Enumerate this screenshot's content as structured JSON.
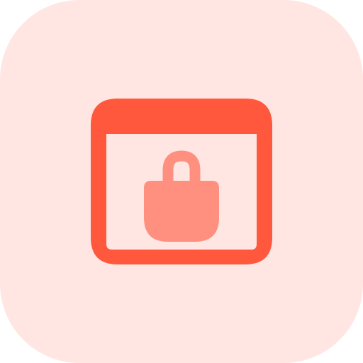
{
  "icon": {
    "name": "secure-browser-lock-icon",
    "background_color": "#FFE6E2",
    "frame_color": "#FF583C",
    "lock_color": "#FF9080"
  }
}
